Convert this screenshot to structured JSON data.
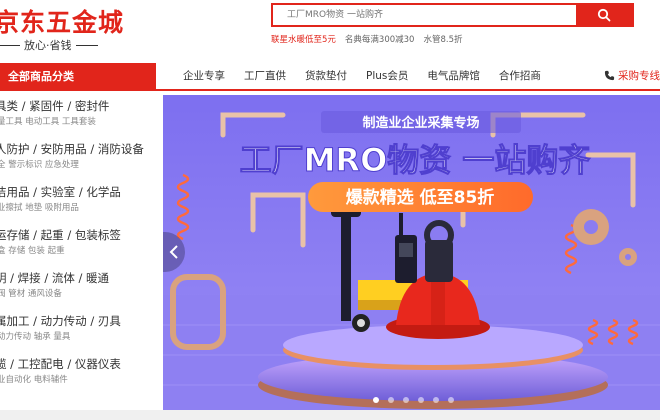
{
  "header": {
    "logo_text": "京东五金城",
    "slogan": "放心·省钱",
    "search_placeholder": "工厂MRO物资 一站购齐",
    "hot_words": [
      {
        "label": "联星水暖低至5元",
        "hot": true
      },
      {
        "label": "名典每满300减30",
        "hot": false
      },
      {
        "label": "水管8.5折",
        "hot": false
      }
    ]
  },
  "nav": {
    "category_title": "全部商品分类",
    "items": [
      "企业专享",
      "工厂直供",
      "货款垫付",
      "Plus会员",
      "电气品牌馆",
      "合作招商"
    ],
    "purchase_label": "采购专线"
  },
  "sidebar": {
    "categories": [
      {
        "title": "具类 / 紧固件 / 密封件",
        "sub": "量工具  电动工具  工具套装"
      },
      {
        "title": "人防护 / 安防用品 / 消防设备",
        "sub": "全  警示标识  应急处理"
      },
      {
        "title": "洁用品 / 实验室 / 化学品",
        "sub": "业擦拭  地垫  吸附用品"
      },
      {
        "title": "运存储 / 起重 / 包装标签",
        "sub": "盒  存储  包装  起重"
      },
      {
        "title": "明 / 焊接 / 流体 / 暖通",
        "sub": "阀  管材  通风设备"
      },
      {
        "title": "属加工 / 动力传动 / 刃具",
        "sub": "动力传动  轴承  量具"
      },
      {
        "title": "缆 / 工控配电 / 仪器仪表",
        "sub": "业自动化  电料辅件"
      }
    ]
  },
  "banner": {
    "top_text": "制造业企业采集专场",
    "headline": "工厂MRO物资 一站购齐",
    "promo": "爆款精选 低至85折",
    "dots": 6,
    "active_dot": 0
  },
  "colors": {
    "brand_red": "#e1251b",
    "banner_purple": "#8c7cf0",
    "promo_orange": "#ff7a2b"
  }
}
